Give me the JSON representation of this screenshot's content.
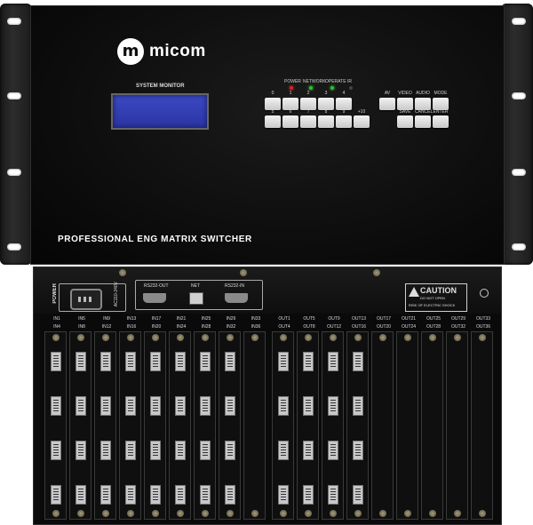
{
  "front_panel": {
    "brand": "micom",
    "brand_mark": "m",
    "system_monitor_label": "SYSTEM MONITOR",
    "model_title": "PROFESSIONAL ENG MATRIX SWITCHER",
    "indicators": [
      {
        "label": "POWER",
        "color": "#e02020"
      },
      {
        "label": "NETWORK",
        "color": "#2fbf2f"
      },
      {
        "label": "OPERATE",
        "color": "#2fbf2f"
      },
      {
        "label": "IR",
        "color": "#444444"
      }
    ],
    "keypad_top_numbers": [
      "0",
      "1",
      "2",
      "3",
      "4"
    ],
    "keypad_bottom_numbers": [
      "5",
      "6",
      "7",
      "8",
      "9",
      "+10"
    ],
    "function_top_labels": [
      "AV",
      "VIDEO",
      "AUDIO",
      "MODE"
    ],
    "function_bottom_labels": [
      "SAVE",
      "CANCEL",
      "ENTER"
    ]
  },
  "rear_panel": {
    "power_label": "POWER",
    "voltage_label": "AC110-240V",
    "rs232_out_label": "RS232-OUT",
    "net_label": "NET",
    "rs232_in_label": "RS232-IN",
    "caution": {
      "title": "CAUTION",
      "line1": "DO NOT OPEN",
      "line2": "RISK OF ELECTRIC SHOCK"
    },
    "input_groups": [
      {
        "top": "IN1",
        "bottom": "IN4"
      },
      {
        "top": "IN5",
        "bottom": "IN8"
      },
      {
        "top": "IN9",
        "bottom": "IN12"
      },
      {
        "top": "IN13",
        "bottom": "IN16"
      },
      {
        "top": "IN17",
        "bottom": "IN20"
      },
      {
        "top": "IN21",
        "bottom": "IN24"
      },
      {
        "top": "IN25",
        "bottom": "IN28"
      },
      {
        "top": "IN29",
        "bottom": "IN32"
      },
      {
        "top": "IN33",
        "bottom": "IN36"
      }
    ],
    "output_groups": [
      {
        "top": "OUT1",
        "bottom": "OUT4"
      },
      {
        "top": "OUT5",
        "bottom": "OUT8"
      },
      {
        "top": "OUT9",
        "bottom": "OUT12"
      },
      {
        "top": "OUT13",
        "bottom": "OUT16"
      },
      {
        "top": "OUT17",
        "bottom": "OUT20"
      },
      {
        "top": "OUT21",
        "bottom": "OUT24"
      },
      {
        "top": "OUT25",
        "bottom": "OUT28"
      },
      {
        "top": "OUT29",
        "bottom": "OUT32"
      },
      {
        "top": "OUT33",
        "bottom": "OUT36"
      }
    ],
    "populated_input_cards": 8,
    "populated_output_cards": 4
  }
}
